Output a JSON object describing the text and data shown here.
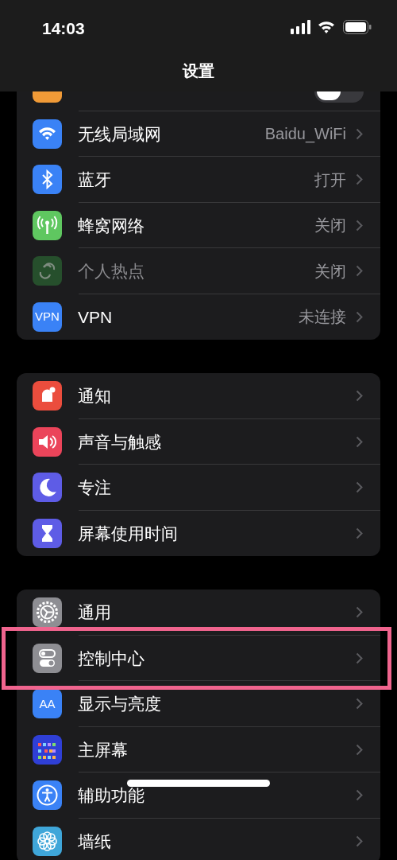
{
  "status_bar": {
    "time": "14:03"
  },
  "title": "设置",
  "airplane_row": {
    "toggle_on": false
  },
  "groups": [
    {
      "rows": [
        {
          "kind": "wifi",
          "label": "无线局域网",
          "value": "Baidu_WiFi",
          "disabled": false,
          "highlighted": false
        },
        {
          "kind": "bluetooth",
          "label": "蓝牙",
          "value": "打开",
          "disabled": false,
          "highlighted": false
        },
        {
          "kind": "cellular",
          "label": "蜂窝网络",
          "value": "关闭",
          "disabled": false,
          "highlighted": false
        },
        {
          "kind": "hotspot",
          "label": "个人热点",
          "value": "关闭",
          "disabled": true,
          "highlighted": false
        },
        {
          "kind": "vpn",
          "icon_text": "VPN",
          "label": "VPN",
          "value": "未连接",
          "disabled": false,
          "highlighted": false
        }
      ]
    },
    {
      "rows": [
        {
          "kind": "notifications",
          "label": "通知",
          "disabled": false,
          "highlighted": false
        },
        {
          "kind": "sound",
          "label": "声音与触感",
          "disabled": false,
          "highlighted": false
        },
        {
          "kind": "focus",
          "label": "专注",
          "disabled": false,
          "highlighted": false
        },
        {
          "kind": "screentime",
          "label": "屏幕使用时间",
          "disabled": false,
          "highlighted": false
        }
      ]
    },
    {
      "rows": [
        {
          "kind": "general",
          "label": "通用",
          "disabled": false,
          "highlighted": false
        },
        {
          "kind": "control",
          "label": "控制中心",
          "disabled": false,
          "highlighted": true
        },
        {
          "kind": "display",
          "icon_text": "AA",
          "label": "显示与亮度",
          "disabled": false,
          "highlighted": false
        },
        {
          "kind": "home",
          "label": "主屏幕",
          "disabled": false,
          "highlighted": false
        },
        {
          "kind": "accessibility",
          "label": "辅助功能",
          "disabled": false,
          "highlighted": false
        },
        {
          "kind": "wallpaper",
          "label": "墙纸",
          "disabled": false,
          "highlighted": false
        }
      ]
    }
  ]
}
